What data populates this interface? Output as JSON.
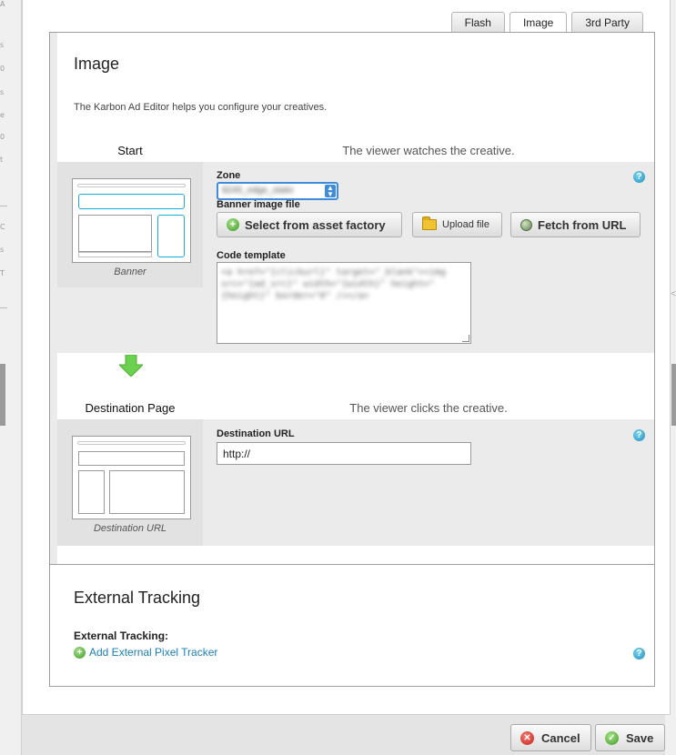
{
  "tabs": [
    {
      "label": "Flash",
      "active": false
    },
    {
      "label": "Image",
      "active": true
    },
    {
      "label": "3rd Party",
      "active": false
    }
  ],
  "image_section": {
    "title": "Image",
    "intro": "The Karbon Ad Editor helps you configure your creatives."
  },
  "start_stage": {
    "label": "Start",
    "description": "The viewer watches the creative.",
    "icon_caption": "Banner",
    "zone_label": "Zone",
    "zone_value": "8245_edge_static",
    "banner_label": "Banner image file",
    "select_asset_label": "Select from asset factory",
    "upload_label": "Upload file",
    "fetch_label": "Fetch from URL",
    "code_label": "Code template",
    "code_value": "<a href=\"{clickurl}\" target=\"_blank\"><img src=\"{ad_src}\" width=\"{width}\" height=\"{height}\" border=\"0\" /></a>"
  },
  "destination_stage": {
    "label": "Destination Page",
    "description": "The viewer clicks the creative.",
    "icon_caption": "Destination URL",
    "url_label": "Destination URL",
    "url_value": "http://"
  },
  "tracking": {
    "title": "External Tracking",
    "label": "External Tracking:",
    "add_link": "Add External Pixel Tracker"
  },
  "help_glyph": "?",
  "footer": {
    "cancel_label": "Cancel",
    "save_label": "Save"
  },
  "colors": {
    "accent_cyan": "#1aaed9",
    "link_blue": "#1a7fb8",
    "focus_blue": "#3f8bdc",
    "arrow_green": "#6dd04e"
  }
}
